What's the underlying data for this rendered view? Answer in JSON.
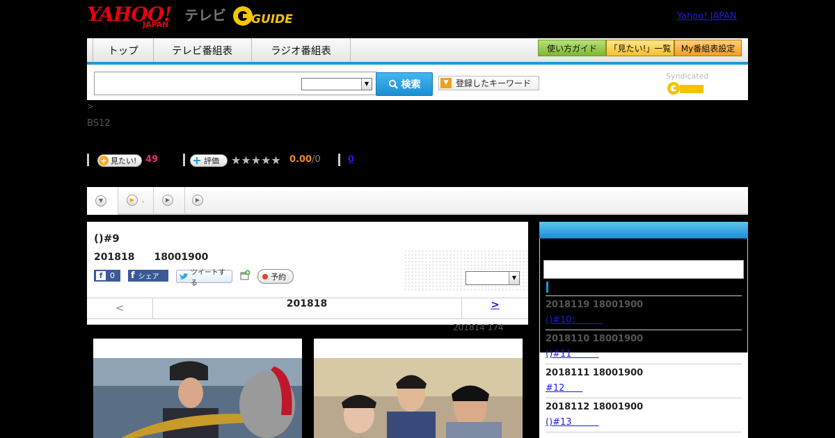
{
  "header": {
    "yahoo_logo": "YAHOO!",
    "yahoo_logo_sub": "JAPAN",
    "tv_label": "テレビ",
    "gguide_logo": "GUIDE",
    "yahoo_japan_link": "Yahoo! JAPAN"
  },
  "nav": {
    "tabs": [
      {
        "label": "トップ"
      },
      {
        "label": "テレビ番組表"
      },
      {
        "label": "ラジオ番組表"
      }
    ],
    "right_buttons": [
      {
        "label": "使い方ガイド",
        "color": "#8cc63f"
      },
      {
        "label": "「見たい!」一覧",
        "color": "#f7c948"
      },
      {
        "label": "My番組表設定",
        "color": "#f5a623"
      }
    ]
  },
  "search": {
    "search_button_label": "検索",
    "keyword_button_label": "登録したキーワード",
    "syndicated_label": "Syndicated"
  },
  "program": {
    "breadcrumb": ">",
    "channel": "BS12",
    "mitai_label": "見たい!",
    "mitai_count": "49",
    "hyoka_label": "評価",
    "stars_text": "★★★★★",
    "rating": "0.00",
    "rating_count": "/0",
    "review_count": "0"
  },
  "tabs_strip": {
    "tab2_suffix": "."
  },
  "episode": {
    "title": "()#9",
    "datetime": "201818　　18001900",
    "fb_count": "0",
    "fb_share_label": "シェア",
    "tweet_label": "ツイートする",
    "reserve_label": "予約",
    "pager_prev": "<",
    "pager_current": "201818",
    "pager_next": ">",
    "meta": "201814  174"
  },
  "side": {
    "episodes": [
      {
        "date": "2018119  18001900",
        "link": "()#10：　　　"
      },
      {
        "date": "2018110  18001900",
        "link": "()#11　　　"
      },
      {
        "date": "2018111  18001900",
        "link": "#12　　"
      },
      {
        "date": "2018112  18001900",
        "link": "()#13　　　"
      }
    ]
  },
  "colors": {
    "accent": "#1b9ad8",
    "link": "#1a1ae6",
    "mitai_count": "#e62e6b",
    "rating": "#e8882a"
  }
}
